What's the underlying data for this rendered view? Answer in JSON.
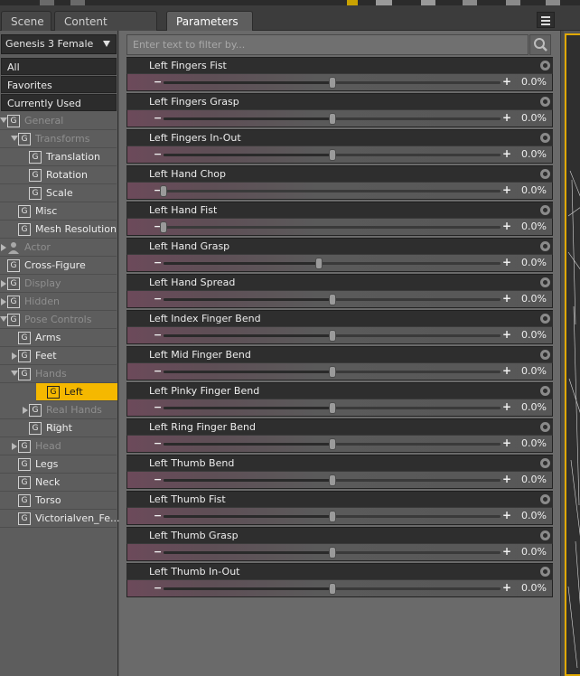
{
  "tabs": [
    {
      "label": "Scene",
      "active": false
    },
    {
      "label": "Content Library",
      "active": false
    },
    {
      "label": "Parameters",
      "active": true
    }
  ],
  "left": {
    "figure": "Genesis 3 Female",
    "nav": [
      "All",
      "Favorites",
      "Currently Used"
    ],
    "tree": [
      {
        "label": "General",
        "indent": 0,
        "arrow": "down",
        "icon": "g",
        "style": "dim"
      },
      {
        "label": "Transforms",
        "indent": 1,
        "arrow": "down",
        "icon": "g",
        "style": "dim"
      },
      {
        "label": "Translation",
        "indent": 2,
        "arrow": "",
        "icon": "g",
        "style": "norm"
      },
      {
        "label": "Rotation",
        "indent": 2,
        "arrow": "",
        "icon": "g",
        "style": "norm"
      },
      {
        "label": "Scale",
        "indent": 2,
        "arrow": "",
        "icon": "g",
        "style": "norm"
      },
      {
        "label": "Misc",
        "indent": 1,
        "arrow": "",
        "icon": "g",
        "style": "norm"
      },
      {
        "label": "Mesh Resolution",
        "indent": 1,
        "arrow": "",
        "icon": "g",
        "style": "norm"
      },
      {
        "label": "Actor",
        "indent": 0,
        "arrow": "right",
        "icon": "person",
        "style": "dim"
      },
      {
        "label": "Cross-Figure",
        "indent": 0,
        "arrow": "",
        "icon": "g",
        "style": "norm"
      },
      {
        "label": "Display",
        "indent": 0,
        "arrow": "right",
        "icon": "g",
        "style": "dim"
      },
      {
        "label": "Hidden",
        "indent": 0,
        "arrow": "right",
        "icon": "g",
        "style": "dim"
      },
      {
        "label": "Pose Controls",
        "indent": 0,
        "arrow": "down",
        "icon": "g",
        "style": "dim"
      },
      {
        "label": "Arms",
        "indent": 1,
        "arrow": "",
        "icon": "g",
        "style": "norm"
      },
      {
        "label": "Feet",
        "indent": 1,
        "arrow": "right",
        "icon": "g",
        "style": "norm"
      },
      {
        "label": "Hands",
        "indent": 1,
        "arrow": "down",
        "icon": "g",
        "style": "dim"
      },
      {
        "label": "Left",
        "indent": 2,
        "arrow": "",
        "icon": "g",
        "style": "sel"
      },
      {
        "label": "Real Hands HD",
        "indent": 2,
        "arrow": "right",
        "icon": "g",
        "style": "dim"
      },
      {
        "label": "Right",
        "indent": 2,
        "arrow": "",
        "icon": "g",
        "style": "norm"
      },
      {
        "label": "Head",
        "indent": 1,
        "arrow": "right",
        "icon": "g",
        "style": "dim"
      },
      {
        "label": "Legs",
        "indent": 1,
        "arrow": "",
        "icon": "g",
        "style": "norm"
      },
      {
        "label": "Neck",
        "indent": 1,
        "arrow": "",
        "icon": "g",
        "style": "norm"
      },
      {
        "label": "Torso",
        "indent": 1,
        "arrow": "",
        "icon": "g",
        "style": "norm"
      },
      {
        "label": "Victorialven_Fe...",
        "indent": 1,
        "arrow": "",
        "icon": "g",
        "style": "norm"
      }
    ]
  },
  "filter": {
    "placeholder": "Enter text to filter by..."
  },
  "params": [
    {
      "name": "Left Fingers Fist",
      "value": "0.0%",
      "pos": 0.5
    },
    {
      "name": "Left Fingers Grasp",
      "value": "0.0%",
      "pos": 0.5
    },
    {
      "name": "Left Fingers In-Out",
      "value": "0.0%",
      "pos": 0.5
    },
    {
      "name": "Left Hand Chop",
      "value": "0.0%",
      "pos": 0.0
    },
    {
      "name": "Left Hand Fist",
      "value": "0.0%",
      "pos": 0.0
    },
    {
      "name": "Left Hand Grasp",
      "value": "0.0%",
      "pos": 0.46
    },
    {
      "name": "Left Hand Spread",
      "value": "0.0%",
      "pos": 0.5
    },
    {
      "name": "Left Index Finger Bend",
      "value": "0.0%",
      "pos": 0.5
    },
    {
      "name": "Left Mid Finger Bend",
      "value": "0.0%",
      "pos": 0.5
    },
    {
      "name": "Left Pinky Finger Bend",
      "value": "0.0%",
      "pos": 0.5
    },
    {
      "name": "Left Ring Finger Bend",
      "value": "0.0%",
      "pos": 0.5
    },
    {
      "name": "Left Thumb Bend",
      "value": "0.0%",
      "pos": 0.5
    },
    {
      "name": "Left Thumb Fist",
      "value": "0.0%",
      "pos": 0.5
    },
    {
      "name": "Left Thumb Grasp",
      "value": "0.0%",
      "pos": 0.5
    },
    {
      "name": "Left Thumb In-Out",
      "value": "0.0%",
      "pos": 0.5
    }
  ],
  "colors": {
    "accent": "#f5b800",
    "panel": "#2e2e2e",
    "background": "#6a6a6a"
  }
}
